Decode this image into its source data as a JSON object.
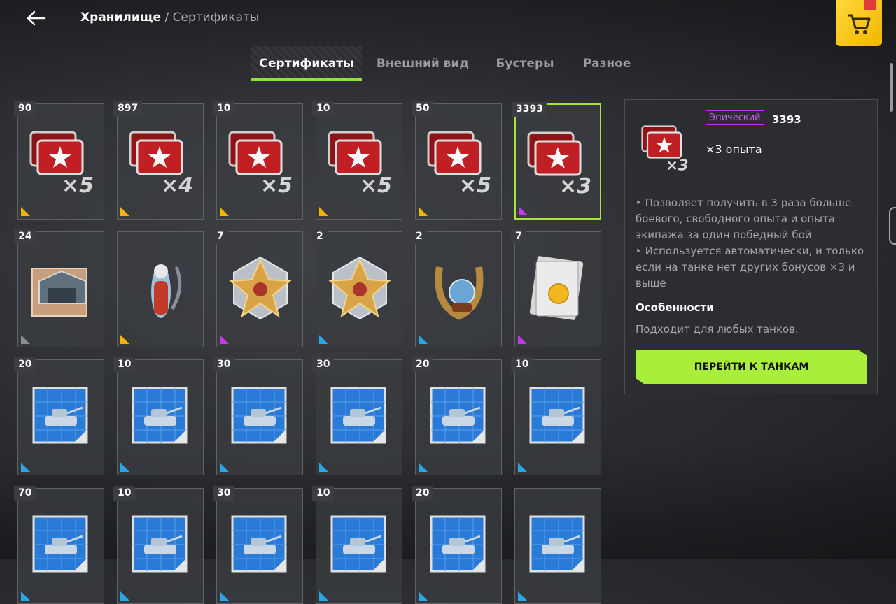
{
  "breadcrumb": {
    "current": "Хранилище",
    "separator": "/",
    "sub": "Сертификаты"
  },
  "tabs": [
    {
      "label": "Сертификаты",
      "active": true
    },
    {
      "label": "Внешний вид",
      "active": false
    },
    {
      "label": "Бустеры",
      "active": false
    },
    {
      "label": "Разное",
      "active": false
    }
  ],
  "colors": {
    "accent": "#a9ee3a",
    "legendary": "#f4b400",
    "epic": "#c43ce8",
    "rare": "#2aa7e8",
    "common": "#8c8c8c"
  },
  "rows": [
    [
      {
        "count": "90",
        "icon": "xp-cards-icon",
        "mult": "×5",
        "rarity": "legendary"
      },
      {
        "count": "897",
        "icon": "xp-cards-icon",
        "mult": "×4",
        "rarity": "legendary"
      },
      {
        "count": "10",
        "icon": "xp-cards-icon",
        "mult": "×5",
        "rarity": "legendary"
      },
      {
        "count": "10",
        "icon": "xp-cards-icon",
        "mult": "×5",
        "rarity": "legendary"
      },
      {
        "count": "50",
        "icon": "xp-cards-icon",
        "mult": "×5",
        "rarity": "legendary"
      },
      {
        "count": "3393",
        "icon": "xp-cards-icon",
        "mult": "×3",
        "rarity": "epic",
        "selected": true
      }
    ],
    [
      {
        "count": "24",
        "icon": "garage-slot-icon",
        "rarity": "common"
      },
      {
        "count": "",
        "icon": "santa-figure-icon",
        "rarity": "legendary"
      },
      {
        "count": "7",
        "icon": "gold-star-medal-icon",
        "rarity": "epic"
      },
      {
        "count": "2",
        "icon": "gold-star-medal-icon",
        "rarity": "rare"
      },
      {
        "count": "2",
        "icon": "horseshoe-globe-icon",
        "rarity": "rare"
      },
      {
        "count": "7",
        "icon": "document-coin-icon",
        "rarity": "epic"
      }
    ],
    [
      {
        "count": "20",
        "icon": "tank-blueprint-icon",
        "rarity": "rare"
      },
      {
        "count": "10",
        "icon": "tank-blueprint-icon",
        "rarity": "rare"
      },
      {
        "count": "30",
        "icon": "tank-blueprint-icon",
        "rarity": "rare"
      },
      {
        "count": "30",
        "icon": "tank-blueprint-icon",
        "rarity": "rare"
      },
      {
        "count": "20",
        "icon": "tank-blueprint-icon",
        "rarity": "rare"
      },
      {
        "count": "10",
        "icon": "tank-blueprint-icon",
        "rarity": "rare"
      }
    ],
    [
      {
        "count": "70",
        "icon": "tank-blueprint-icon",
        "rarity": "rare"
      },
      {
        "count": "10",
        "icon": "tank-blueprint-icon",
        "rarity": "rare"
      },
      {
        "count": "30",
        "icon": "tank-blueprint-icon",
        "rarity": "rare"
      },
      {
        "count": "10",
        "icon": "tank-blueprint-icon",
        "rarity": "rare"
      },
      {
        "count": "20",
        "icon": "tank-blueprint-icon",
        "rarity": "rare"
      },
      {
        "count": "",
        "icon": "tank-blueprint-icon",
        "rarity": "rare"
      }
    ]
  ],
  "detail": {
    "rarity_label": "Эпический",
    "quantity": "3393",
    "title": "×3 опыта",
    "icon_mult": "×3",
    "desc_1": "‣ Позволяет получить в 3 раза больше боевого, свободного опыта и опыта экипажа за один победный бой",
    "desc_2": "‣ Используется автоматически, и только если на танке нет других бонусов ×3 и выше",
    "features_heading": "Особенности",
    "features_text": "Подходит для любых танков.",
    "cta_label": "ПЕРЕЙТИ К ТАНКАМ"
  }
}
